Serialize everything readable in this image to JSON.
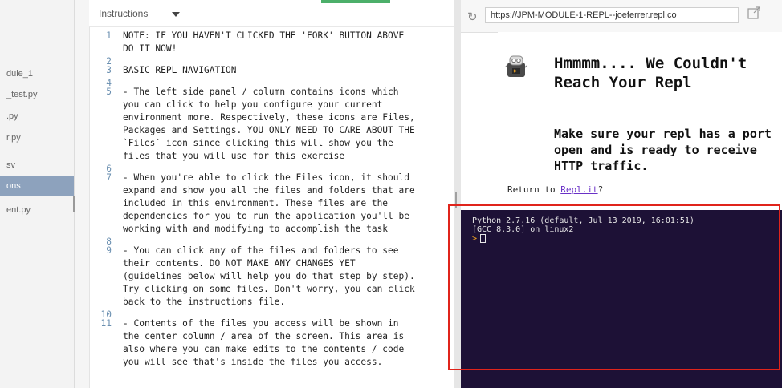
{
  "sidebar": {
    "files": [
      {
        "name": "dule_1",
        "active": false
      },
      {
        "name": "_test.py",
        "active": false
      },
      {
        "name": ".py",
        "active": false
      },
      {
        "name": "r.py",
        "active": false
      },
      {
        "name": "sv",
        "active": false
      },
      {
        "name": "ons",
        "active": true
      },
      {
        "name": "ent.py",
        "active": false
      }
    ]
  },
  "editor": {
    "tab_label": "Instructions",
    "lines": [
      {
        "num": "1",
        "text": "NOTE: IF YOU HAVEN'T CLICKED THE 'FORK' BUTTON ABOVE"
      },
      {
        "num": "",
        "text": "DO IT NOW!"
      },
      {
        "num": "2",
        "text": ""
      },
      {
        "num": "3",
        "text": "BASIC REPL NAVIGATION"
      },
      {
        "num": "4",
        "text": ""
      },
      {
        "num": "5",
        "text": "- The left side panel / column contains icons which"
      },
      {
        "num": "",
        "text": "you can click to help you configure your current"
      },
      {
        "num": "",
        "text": "environment more. Respectively, these icons are Files,"
      },
      {
        "num": "",
        "text": "Packages and Settings. YOU ONLY NEED TO CARE ABOUT THE"
      },
      {
        "num": "",
        "text": "`Files` icon since clicking this will show you the"
      },
      {
        "num": "",
        "text": "files that you will use for this exercise"
      },
      {
        "num": "6",
        "text": ""
      },
      {
        "num": "7",
        "text": "- When you're able to click the Files icon, it should"
      },
      {
        "num": "",
        "text": "expand and show you all the files and folders that are"
      },
      {
        "num": "",
        "text": "included in this environment. These files are the"
      },
      {
        "num": "",
        "text": "dependencies for you to run the application you'll be"
      },
      {
        "num": "",
        "text": "working with and modifying to accomplish the task"
      },
      {
        "num": "8",
        "text": ""
      },
      {
        "num": "9",
        "text": "- You can click any of the files and folders to see"
      },
      {
        "num": "",
        "text": "their contents. DO NOT MAKE ANY CHANGES YET"
      },
      {
        "num": "",
        "text": "(guidelines below will help you do that step by step)."
      },
      {
        "num": "",
        "text": "Try clicking on some files. Don't worry, you can click"
      },
      {
        "num": "",
        "text": "back to the instructions file."
      },
      {
        "num": "10",
        "text": ""
      },
      {
        "num": "11",
        "text": "- Contents of the files you access will be shown in"
      },
      {
        "num": "",
        "text": "the center column / area of the screen. This area is"
      },
      {
        "num": "",
        "text": "also where you can make edits to the contents / code"
      },
      {
        "num": "",
        "text": "you will see that's inside the files you access."
      }
    ]
  },
  "browser": {
    "url": "https://JPM-MODULE-1-REPL--joeferrer.repl.co",
    "reload_icon": "reload-icon",
    "open_icon": "open-in-new-tab-icon"
  },
  "preview": {
    "title": "Hmmmm.... We Couldn't Reach Your Repl",
    "subtitle": "Make sure your repl has a port open and is ready to receive HTTP traffic.",
    "footer_prefix": "Return to ",
    "footer_link": "Repl.it",
    "footer_suffix": "?"
  },
  "console": {
    "line1": "Python 2.7.16 (default, Jul 13 2019, 16:01:51)",
    "line2": "[GCC 8.3.0] on linux2",
    "prompt": ">"
  },
  "colors": {
    "console_bg": "#1d1136",
    "highlight": "#e0241b",
    "active_file": "#8da2bd",
    "link": "#6a31c7"
  }
}
